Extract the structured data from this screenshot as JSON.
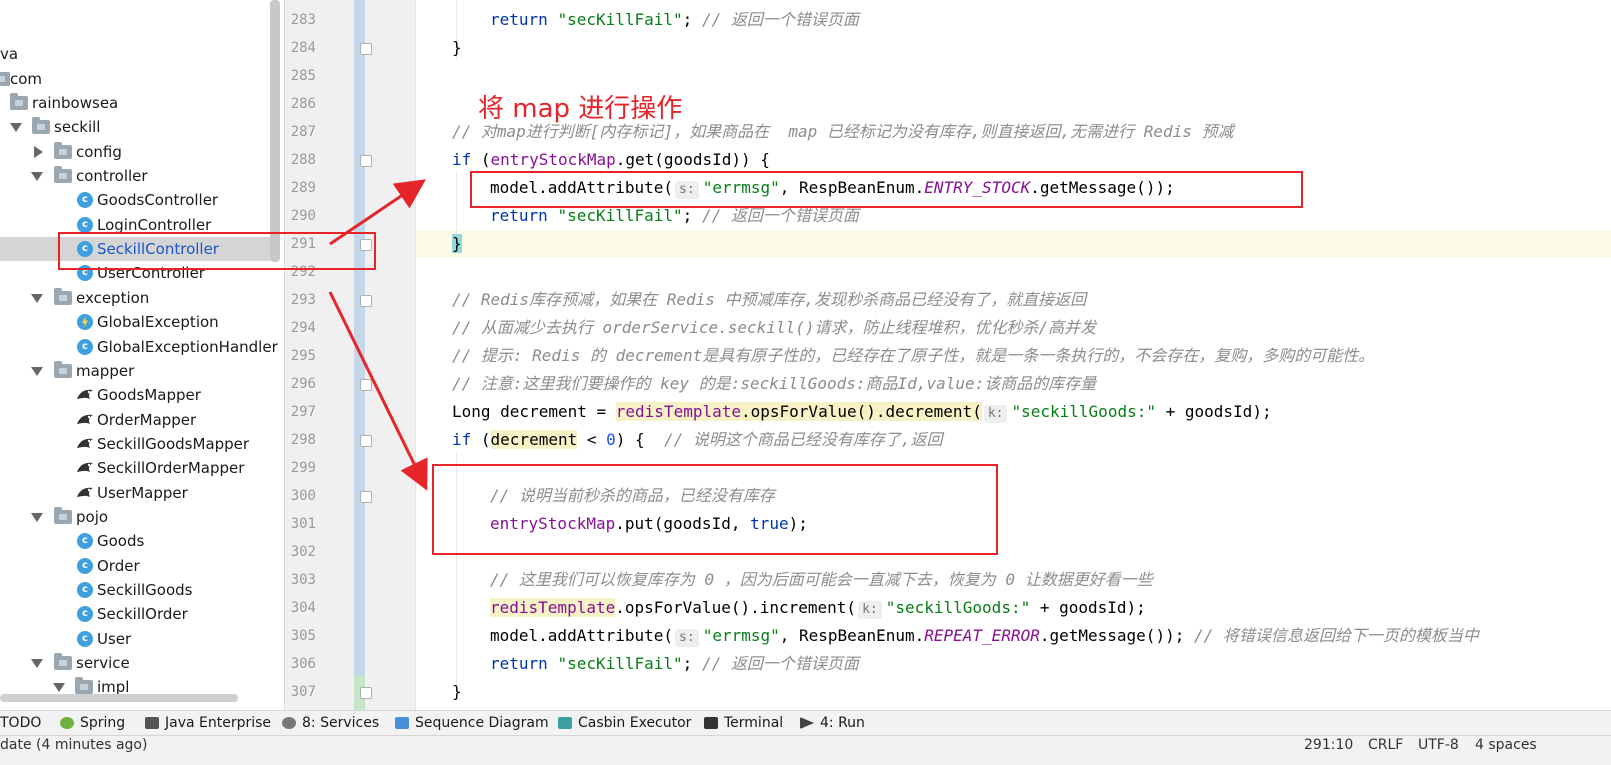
{
  "project_tree": {
    "items": [
      {
        "label": "va"
      },
      {
        "label": "com"
      },
      {
        "label": "rainbowsea"
      },
      {
        "label": "seckill"
      },
      {
        "label": "config"
      },
      {
        "label": "controller"
      },
      {
        "label": "GoodsController"
      },
      {
        "label": "LoginController"
      },
      {
        "label": "SeckillController"
      },
      {
        "label": "UserController"
      },
      {
        "label": "exception"
      },
      {
        "label": "GlobalException"
      },
      {
        "label": "GlobalExceptionHandler"
      },
      {
        "label": "mapper"
      },
      {
        "label": "GoodsMapper"
      },
      {
        "label": "OrderMapper"
      },
      {
        "label": "SeckillGoodsMapper"
      },
      {
        "label": "SeckillOrderMapper"
      },
      {
        "label": "UserMapper"
      },
      {
        "label": "pojo"
      },
      {
        "label": "Goods"
      },
      {
        "label": "Order"
      },
      {
        "label": "SeckillGoods"
      },
      {
        "label": "SeckillOrder"
      },
      {
        "label": "User"
      },
      {
        "label": "service"
      },
      {
        "label": "impl"
      }
    ]
  },
  "gutter": {
    "line_numbers": [
      "283",
      "284",
      "285",
      "286",
      "287",
      "288",
      "289",
      "290",
      "291",
      "292",
      "293",
      "294",
      "295",
      "296",
      "297",
      "298",
      "299",
      "300",
      "301",
      "302",
      "303",
      "304",
      "305",
      "306",
      "307"
    ]
  },
  "code": {
    "l283": {
      "kw": "return",
      "str": "\"secKillFail\"",
      "semi": ";",
      "cmt": "// 返回一个错误页面"
    },
    "l284": {
      "t": "}"
    },
    "l287": {
      "cmt": "// 对map进行判断[内存标记]，如果商品在  map 已经标记为没有库存,则直接返回,无需进行 Redis 预减"
    },
    "l288": {
      "kw": "if",
      "a": " (",
      "fld": "entryStockMap",
      "b": ".get(goodsId)) {"
    },
    "l289": {
      "a": "model.addAttribute(",
      "hint": "s:",
      "str": "\"errmsg\"",
      "b": ", RespBeanEnum.",
      "it": "ENTRY_STOCK",
      "c": ".getMessage());"
    },
    "l290": {
      "kw": "return",
      "str": "\"secKillFail\"",
      "semi": ";",
      "cmt": "// 返回一个错误页面"
    },
    "l291": {
      "t": "}"
    },
    "l293": {
      "cmt": "// Redis库存预减，如果在 Redis 中预减库存,发现秒杀商品已经没有了，就直接返回"
    },
    "l294": {
      "cmt": "// 从面减少去执行 orderService.seckill()请求，防止线程堆积，优化秒杀/高并发"
    },
    "l295": {
      "cmt": "// 提示: Redis 的 decrement是具有原子性的，已经存在了原子性，就是一条一条执行的，不会存在，复购，多购的可能性。"
    },
    "l296": {
      "cmt": "// 注意:这里我们要操作的 key 的是:seckillGoods:商品Id,value:该商品的库存量"
    },
    "l297": {
      "a": "Long decrement = ",
      "fld": "redisTemplate",
      "b": ".opsForValue().decrement(",
      "hint": "k:",
      "str": "\"seckillGoods:\"",
      "c": " + goodsId);"
    },
    "l298": {
      "kw": "if",
      "a": " (",
      "hl": "decrement",
      "b": " < ",
      "num": "0",
      "c": ") {  ",
      "cmt": "// 说明这个商品已经没有库存了,返回"
    },
    "l300": {
      "cmt": "// 说明当前秒杀的商品，已经没有库存"
    },
    "l301": {
      "fld": "entryStockMap",
      "a": ".put(goodsId, ",
      "kw": "true",
      "b": ");"
    },
    "l303": {
      "cmt": "// 这里我们可以恢复库存为 0 ，因为后面可能会一直减下去，恢复为 0 让数据更好看一些"
    },
    "l304": {
      "fld": "redisTemplate",
      "a": ".opsForValue().increment(",
      "hint": "k:",
      "str": "\"seckillGoods:\"",
      "b": " + goodsId);"
    },
    "l305": {
      "a": "model.addAttribute(",
      "hint": "s:",
      "str": "\"errmsg\"",
      "b": ", RespBeanEnum.",
      "it": "REPEAT_ERROR",
      "c": ".getMessage()); ",
      "cmt": "// 将错误信息返回给下一页的模板当中"
    },
    "l306": {
      "kw": "return",
      "str": "\"secKillFail\"",
      "semi": ";",
      "cmt": "// 返回一个错误页面"
    },
    "l307": {
      "t": "}"
    }
  },
  "annotation": {
    "title": "将 map 进行操作"
  },
  "toolwindow_bar": {
    "items": [
      {
        "label": "TODO"
      },
      {
        "label": "Spring"
      },
      {
        "label": "Java Enterprise"
      },
      {
        "label": "8: Services"
      },
      {
        "label": "Sequence Diagram"
      },
      {
        "label": "Casbin Executor"
      },
      {
        "label": "Terminal"
      },
      {
        "label": "4: Run"
      }
    ]
  },
  "status_bar": {
    "message": "date (4 minutes ago)",
    "position": "291:10",
    "line_sep": "CRLF",
    "encoding": "UTF-8",
    "indent": "4 spaces"
  },
  "colors": {
    "annotation_red": "#e6252a",
    "keyword": "#0033b3",
    "string": "#067d17",
    "field": "#871094",
    "comment": "#8c8c8c"
  },
  "icons": {
    "tree_class": "class-c-icon",
    "tree_folder": "folder-icon",
    "tree_mapper": "mybatis-bird-icon",
    "tree_exception": "exception-lightning-icon"
  }
}
